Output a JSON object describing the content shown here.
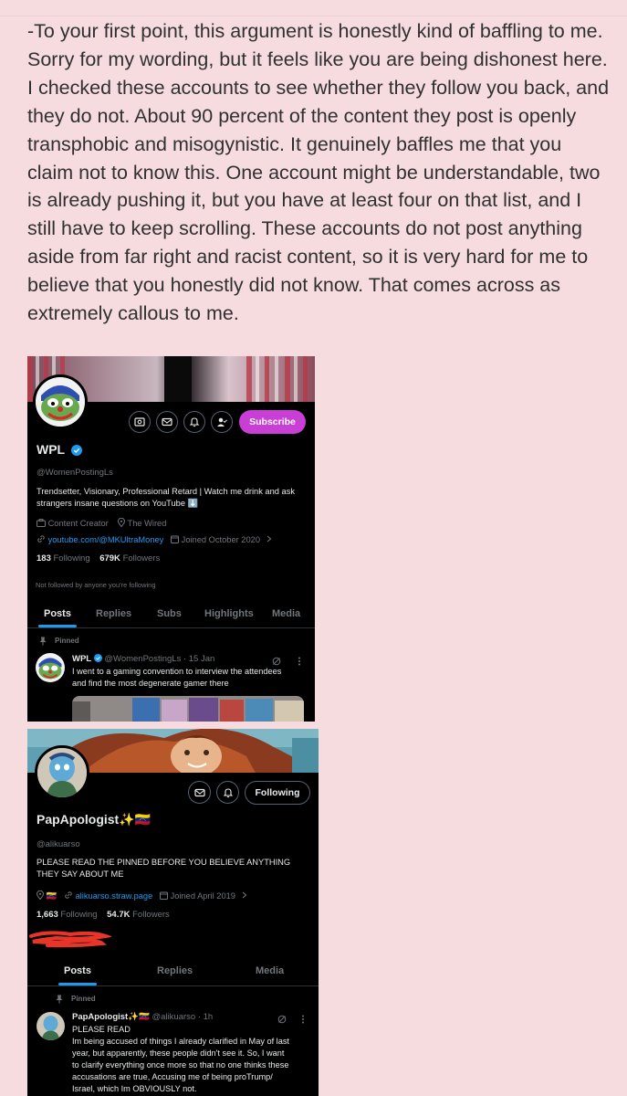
{
  "note": {
    "text": "-To your first point, this argument is honestly kind of baffling to me. Sorry for my wording, but it feels like you are being dishonest here. I checked these accounts to see whether they follow you back, and they do not. About 90 percent of the content they post is openly transphobic and misogynistic. It genuinely baffles me that you claim not to know this. One account might be understandable, two is already pushing it, but you have at least four on that list, and I still have to keep scrolling. These accounts do not post anything aside from far right and racist content, so it is very hard for me to believe that you honestly did not know. That comes across as extremely callous to me."
  },
  "profile1": {
    "name": "WPL",
    "handle": "@WomenPostingLs",
    "subscribe_label": "Subscribe",
    "bio": "Trendsetter, Visionary, Professional Retard | Watch me drink and ask strangers insane questions on YouTube ⬇️",
    "category": "Content Creator",
    "location": "The Wired",
    "website": "youtube.com/@MKUltraMoney",
    "joined": "Joined October 2020",
    "following_count": "183",
    "following_label": "Following",
    "followers_count": "679K",
    "followers_label": "Followers",
    "followed_by": "Not followed by anyone you're following",
    "tabs": [
      "Posts",
      "Replies",
      "Subs",
      "Highlights",
      "Media"
    ],
    "pinned_label": "Pinned",
    "post": {
      "author": "WPL",
      "meta": "@WomenPostingLs · 15 Jan",
      "text_line1": "I went to a gaming convention to interview the attendees",
      "text_line2": "and find the most degenerate gamer there"
    }
  },
  "profile2": {
    "name": "PapApologist✨🇻🇪",
    "handle": "@alikuarso",
    "following_button": "Following",
    "bio_line1": "PLEASE READ THE PINNED BEFORE YOU BELIEVE ANYTHING",
    "bio_line2": "THEY SAY ABOUT ME",
    "location_flag": "🇻🇪",
    "website": "alikuarso.straw.page",
    "joined": "Joined April 2019",
    "following_count": "1,663",
    "following_label": "Following",
    "followers_count": "54.7K",
    "followers_label": "Followers",
    "tabs": [
      "Posts",
      "Replies",
      "Media"
    ],
    "pinned_label": "Pinned",
    "post": {
      "author": "PapApologist✨🇻🇪",
      "meta": "@alikuarso · 1h",
      "line1": "PLEASE READ",
      "line2": "Im being accused of things I already clarified in May of last",
      "line3": "year, but apparently, these people didn't see it. So, I want",
      "line4": "to clarify everything once more so that no one thinks these",
      "line5": "accusations are true, Accusing me of being proTrump/",
      "line6": "Israel, which Im OBVIOUSLY not."
    }
  },
  "colors": {
    "background": "#f6dcdf",
    "subscribe": "#c93fd6",
    "verified": "#1d9bf0",
    "redaction": "#e8352a"
  }
}
